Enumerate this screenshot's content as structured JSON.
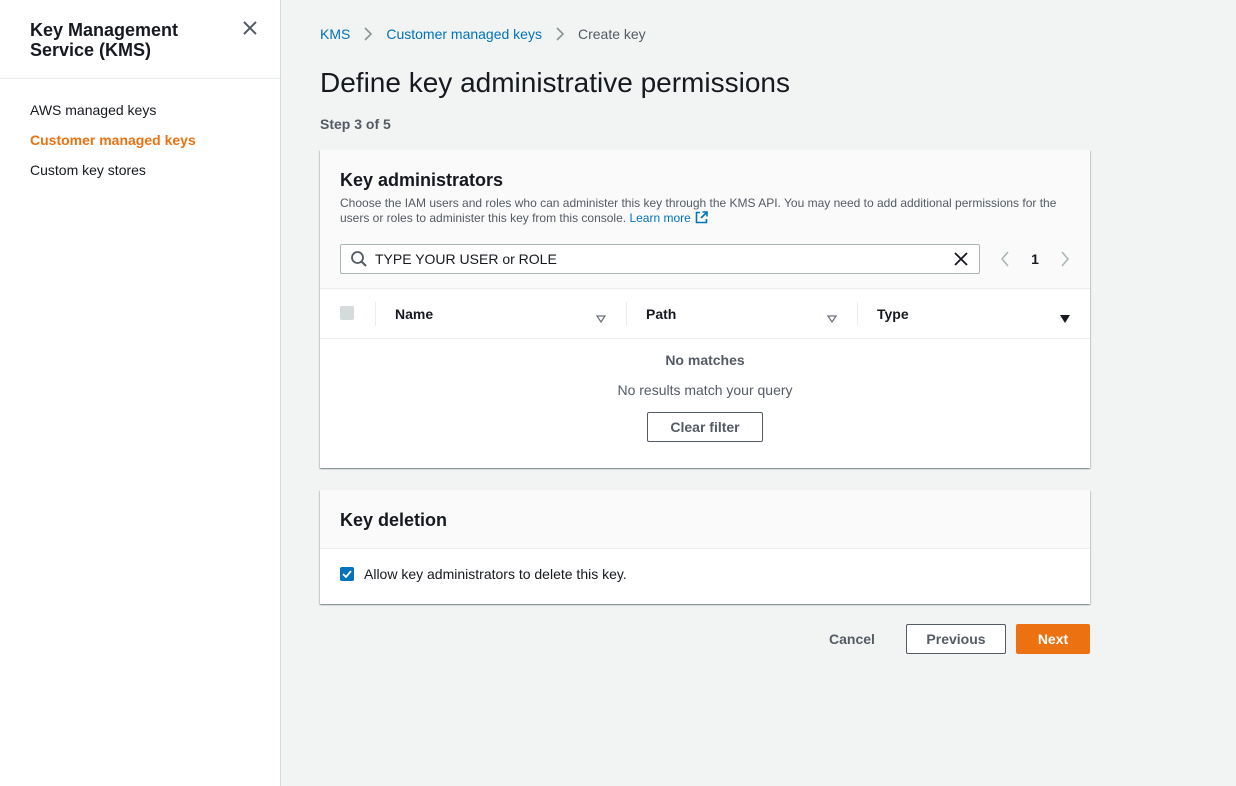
{
  "sidebar": {
    "title": "Key Management Service (KMS)",
    "items": [
      {
        "label": "AWS managed keys",
        "active": false
      },
      {
        "label": "Customer managed keys",
        "active": true
      },
      {
        "label": "Custom key stores",
        "active": false
      }
    ],
    "close_icon": "close-icon"
  },
  "breadcrumb": {
    "items": [
      "KMS",
      "Customer managed keys",
      "Create key"
    ]
  },
  "page": {
    "title": "Define key administrative permissions",
    "step": "Step 3 of 5"
  },
  "key_administrators": {
    "heading": "Key administrators",
    "description": "Choose the IAM users and roles who can administer this key through the KMS API. You may need to add additional permissions for the users or roles to administer this key from this console.",
    "learn_more": "Learn more",
    "search": {
      "value": "TYPE YOUR USER or ROLE",
      "placeholder": ""
    },
    "pagination": {
      "current_page": "1"
    },
    "columns": [
      "Name",
      "Path",
      "Type"
    ],
    "empty": {
      "title": "No matches",
      "message": "No results match your query",
      "clear_button": "Clear filter"
    }
  },
  "key_deletion": {
    "heading": "Key deletion",
    "checkbox_label": "Allow key administrators to delete this key.",
    "checked": true
  },
  "actions": {
    "cancel": "Cancel",
    "previous": "Previous",
    "next": "Next"
  },
  "colors": {
    "accent_orange": "#ec7211",
    "link_blue": "#0073bb",
    "text_dark": "#16191f",
    "text_gray": "#545b64",
    "background": "#f2f3f3"
  }
}
